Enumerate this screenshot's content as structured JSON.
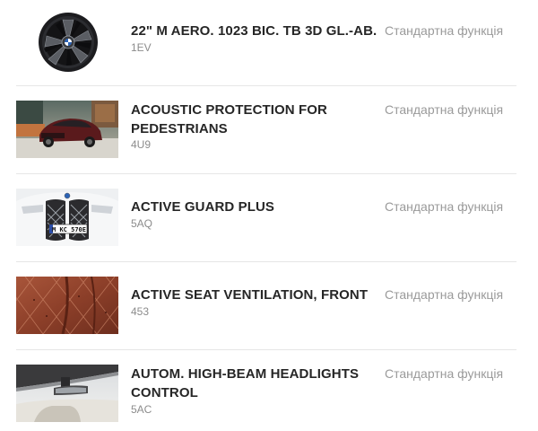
{
  "options": [
    {
      "name": "22\" M AERO. 1023 BIC. TB 3D GL.-AB.",
      "code": "1EV",
      "status": "Стандартна функція",
      "thumbnail_icon": "wheel-rim-icon"
    },
    {
      "name": "ACOUSTIC PROTECTION FOR PEDESTRIANS",
      "code": "4U9",
      "status": "Стандартна функція",
      "thumbnail_icon": "car-driving-image"
    },
    {
      "name": "ACTIVE GUARD PLUS",
      "code": "5AQ",
      "status": "Стандартна функція",
      "thumbnail_icon": "kidney-grille-image"
    },
    {
      "name": "ACTIVE SEAT VENTILATION, FRONT",
      "code": "453",
      "status": "Стандартна функція",
      "thumbnail_icon": "leather-seat-image"
    },
    {
      "name": "AUTOM. HIGH-BEAM HEADLIGHTS CONTROL",
      "code": "5AC",
      "status": "Стандартна функція",
      "thumbnail_icon": "windshield-mirror-image"
    }
  ],
  "plate_text": "M KC 570E"
}
